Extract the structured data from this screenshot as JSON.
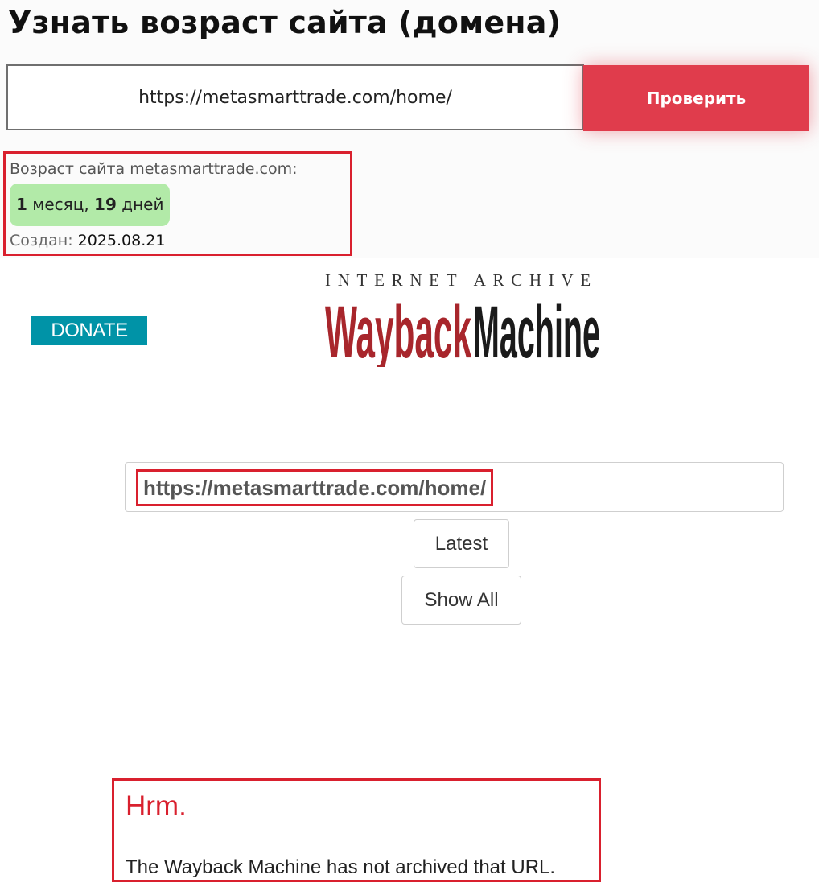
{
  "age_checker": {
    "title": "Узнать возраст сайта (домена)",
    "url_value": "https://metasmarttrade.com/home/",
    "check_button_label": "Проверить",
    "age_label": "Возраст сайта metasmarttrade.com:",
    "age_months": "1",
    "age_months_unit": "месяц,",
    "age_days": "19",
    "age_days_unit": "дней",
    "created_label": "Создан:",
    "created_date": "2025.08.21"
  },
  "wayback": {
    "donate_label": "DONATE",
    "logo_top_text": "INTERNET ARCHIVE",
    "logo_word_1": "Wayback",
    "logo_word_2": "Machine",
    "url_value": "https://metasmarttrade.com/home/",
    "latest_label": "Latest",
    "show_all_label": "Show All",
    "error_title": "Hrm.",
    "error_message": "The Wayback Machine has not archived that URL."
  },
  "colors": {
    "accent_red": "#e03c4c",
    "highlight_red": "#d9202e",
    "age_badge_green": "#b2eaa8",
    "donate_teal": "#0093a7",
    "logo_red": "#a8262c"
  }
}
